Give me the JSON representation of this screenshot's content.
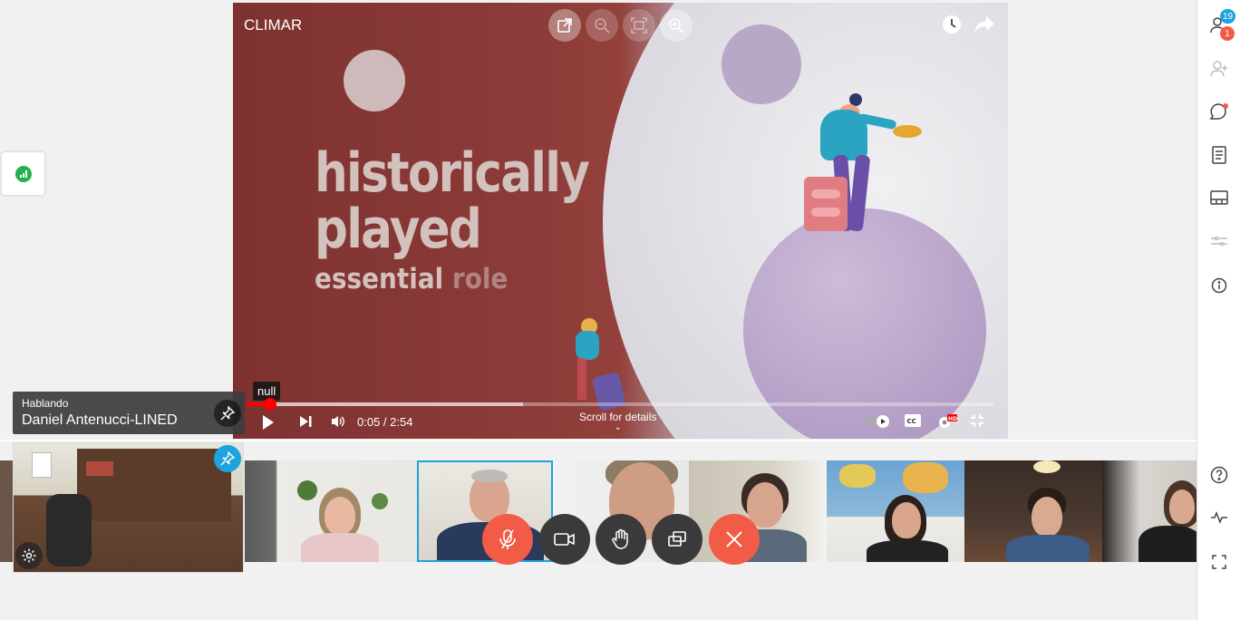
{
  "video": {
    "title": "CLIMAR",
    "headline_line1": "historically",
    "headline_line2": "played",
    "headline_line3a": "essential",
    "headline_line3b": "role",
    "tooltip": "null",
    "timecode": "0:05 / 2:54",
    "scroll_hint": "Scroll for details",
    "progress_played": 0.032,
    "progress_buffered": 0.37
  },
  "speaker": {
    "label": "Hablando",
    "name": "Daniel Antenucci-LINED"
  },
  "rail": {
    "participants_count": "19",
    "notifications_count": "1"
  },
  "colors": {
    "accent": "#1da3dd",
    "hangup": "#f25b45",
    "progress": "#ff0000"
  }
}
